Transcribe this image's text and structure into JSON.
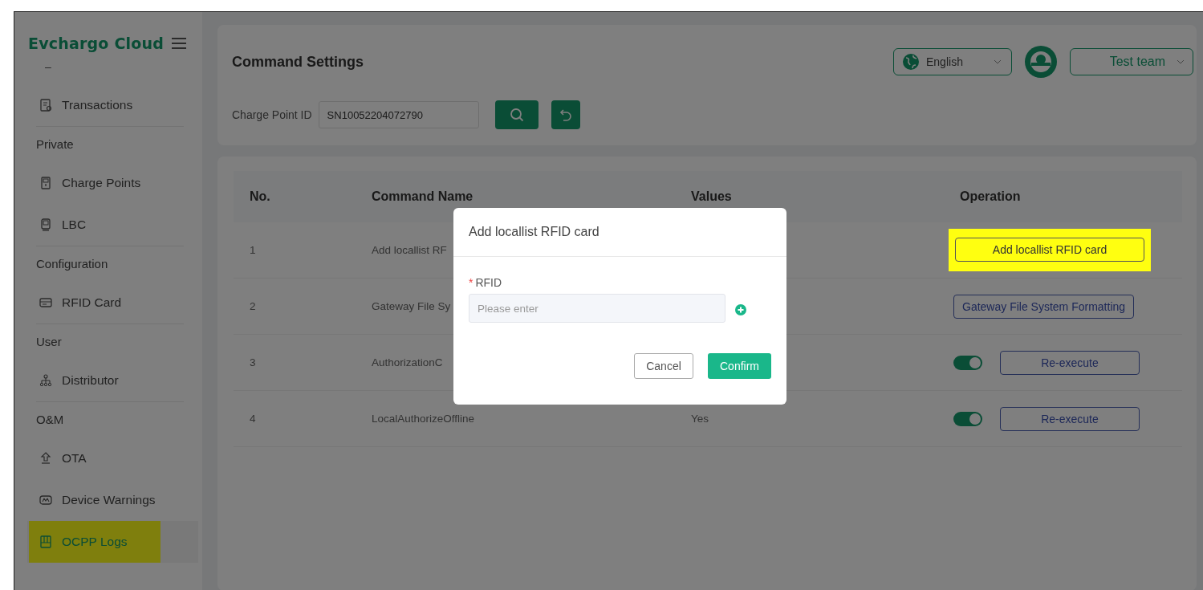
{
  "brand": {
    "name": "Evchargo Cloud"
  },
  "sidebar": {
    "top_remnant": "–",
    "groups": [
      {
        "items": [
          {
            "label": "Transactions",
            "kind": "receipt",
            "selected": false,
            "highlighted": false
          }
        ]
      },
      {
        "heading": "Private",
        "items": [
          {
            "label": "Charge Points",
            "kind": "charger",
            "selected": false,
            "highlighted": false
          },
          {
            "label": "LBC",
            "kind": "device",
            "selected": false,
            "highlighted": false
          }
        ]
      },
      {
        "heading": "Configuration",
        "items": [
          {
            "label": "RFID Card",
            "kind": "card",
            "selected": false,
            "highlighted": false
          }
        ]
      },
      {
        "heading": "User",
        "items": [
          {
            "label": "Distributor",
            "kind": "tree",
            "selected": false,
            "highlighted": false
          }
        ]
      },
      {
        "heading": "O&M",
        "items": [
          {
            "label": "OTA",
            "kind": "upload",
            "selected": false,
            "highlighted": false
          },
          {
            "label": "Device Warnings",
            "kind": "warning",
            "selected": false,
            "highlighted": false
          },
          {
            "label": "OCPP Logs",
            "kind": "log",
            "selected": true,
            "highlighted": true
          }
        ]
      }
    ]
  },
  "header": {
    "title": "Command Settings",
    "language": "English",
    "team": "Test team",
    "filter_label": "Charge Point ID",
    "filter_value": "SN10052204072790"
  },
  "table": {
    "columns": [
      "No.",
      "Command Name",
      "Values",
      "Operation"
    ],
    "rows": [
      {
        "no": "1",
        "name": "Add locallist RF",
        "operation": {
          "kind": "button",
          "label": "Add locallist RFID card",
          "highlighted": true
        }
      },
      {
        "no": "2",
        "name": "Gateway File Sy",
        "operation": {
          "kind": "button",
          "label": "Gateway File System Formatting",
          "highlighted": false
        }
      },
      {
        "no": "3",
        "name": "AuthorizationC",
        "operation": {
          "kind": "toggle",
          "on": true,
          "label": "Re-execute",
          "highlighted": false
        }
      },
      {
        "no": "4",
        "name": "LocalAuthorizeOffline",
        "value": "Yes",
        "operation": {
          "kind": "toggle",
          "on": true,
          "label": "Re-execute",
          "highlighted": false
        }
      }
    ]
  },
  "dialog": {
    "title": "Add locallist RFID card",
    "required_mark": "*",
    "field_label": "RFID",
    "placeholder": "Please enter",
    "buttons": [
      {
        "label": "Cancel",
        "kind": "secondary"
      },
      {
        "label": "Confirm",
        "kind": "primary"
      }
    ]
  }
}
